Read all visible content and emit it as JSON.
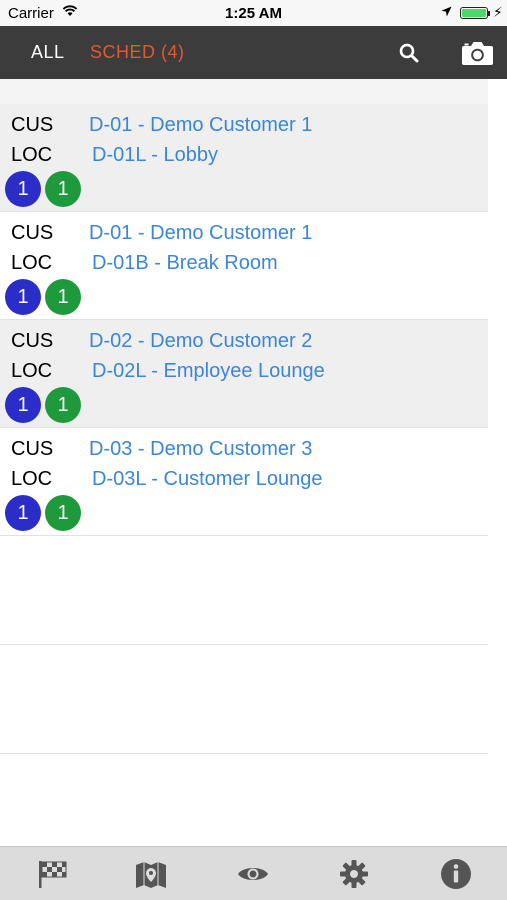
{
  "status_bar": {
    "carrier": "Carrier",
    "time": "1:25 AM",
    "battery_color": "#4cd964"
  },
  "nav": {
    "tabs": [
      {
        "label": "ALL",
        "active": false
      },
      {
        "label": "SCHED (4)",
        "active": true
      }
    ],
    "active_color": "#e5572d",
    "icons": [
      "search-icon",
      "camera-icon"
    ]
  },
  "list": {
    "customer_label": "CUS",
    "location_label": "LOC",
    "rows": [
      {
        "customer": "D-01 - Demo Customer 1",
        "location": "D-01L - Lobby",
        "badge_blue": "1",
        "badge_green": "1"
      },
      {
        "customer": "D-01 - Demo Customer 1",
        "location": "D-01B - Break Room",
        "badge_blue": "1",
        "badge_green": "1"
      },
      {
        "customer": "D-02 - Demo Customer 2",
        "location": "D-02L - Employee Lounge",
        "badge_blue": "1",
        "badge_green": "1"
      },
      {
        "customer": "D-03 - Demo Customer 3",
        "location": "D-03L - Customer Lounge",
        "badge_blue": "1",
        "badge_green": "1"
      }
    ],
    "link_color": "#3b86d8",
    "badge_colors": {
      "blue": "#2a2dc7",
      "green": "#1e9a3d"
    }
  },
  "tab_bar": {
    "icons": [
      "checkered-flag-icon",
      "map-pin-icon",
      "eye-icon",
      "gear-icon",
      "info-icon"
    ]
  }
}
